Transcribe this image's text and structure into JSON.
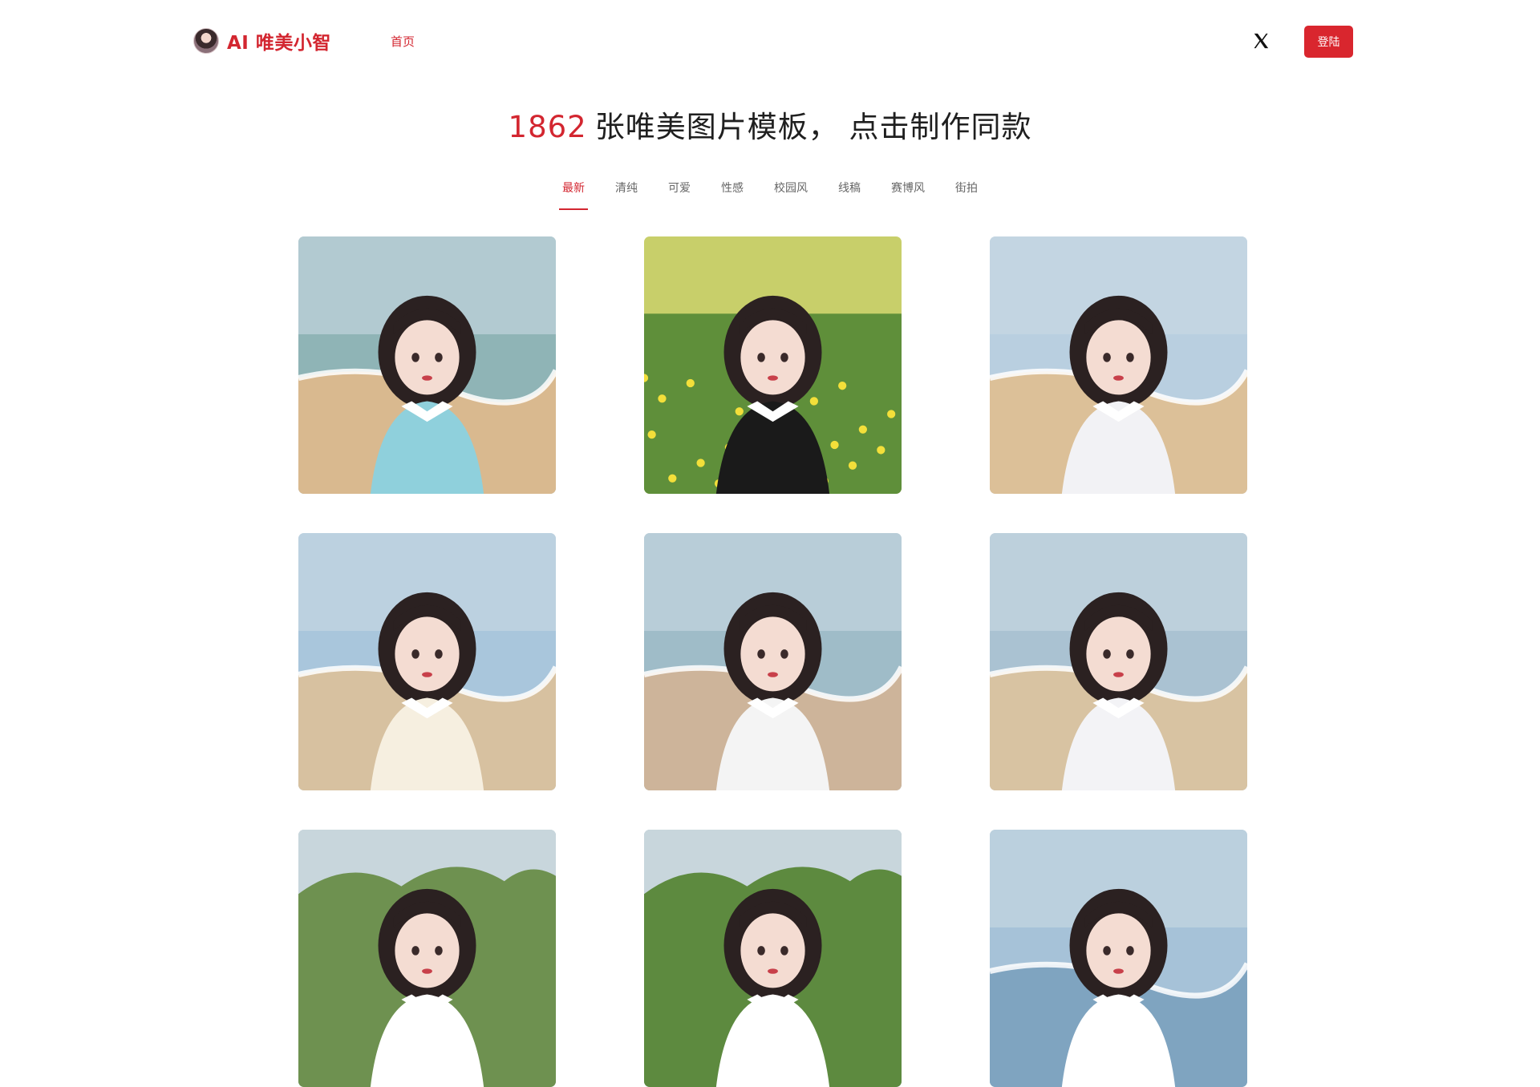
{
  "header": {
    "brand": "AI 唯美小智",
    "nav_home": "首页",
    "login_label": "登陆"
  },
  "hero": {
    "count": "1862",
    "text": "张唯美图片模板， 点击制作同款"
  },
  "tabs": [
    {
      "label": "最新",
      "active": true
    },
    {
      "label": "清纯",
      "active": false
    },
    {
      "label": "可爱",
      "active": false
    },
    {
      "label": "性感",
      "active": false
    },
    {
      "label": "校园风",
      "active": false
    },
    {
      "label": "线稿",
      "active": false
    },
    {
      "label": "赛博风",
      "active": false
    },
    {
      "label": "街拍",
      "active": false
    }
  ],
  "colors": {
    "accent": "#d32630",
    "button_bg": "#d9262e"
  },
  "icons": {
    "x": "x-logo-icon",
    "avatar": "avatar"
  },
  "gallery": [
    {
      "scene": "beach",
      "sky": "#8fb4b6",
      "ground": "#d9b98f",
      "dress": "#8fd0dc"
    },
    {
      "scene": "meadow",
      "sky": "#c8cf6a",
      "ground": "#5f8f3a",
      "dress": "#1a1a1a"
    },
    {
      "scene": "beach",
      "sky": "#b9cfe0",
      "ground": "#dcc098",
      "dress": "#f2f2f5"
    },
    {
      "scene": "beach",
      "sky": "#a9c6dc",
      "ground": "#d7c1a0",
      "dress": "#f6efe0"
    },
    {
      "scene": "beach",
      "sky": "#9fbcc8",
      "ground": "#cdb49a",
      "dress": "#f4f4f4"
    },
    {
      "scene": "beach",
      "sky": "#aac2d2",
      "ground": "#d8c3a2",
      "dress": "#f3f3f6"
    },
    {
      "scene": "forest",
      "sky": "#b3c7cf",
      "ground": "#6e9150",
      "dress": "#ffffff"
    },
    {
      "scene": "forest",
      "sky": "#a7bfc6",
      "ground": "#5d8a3f",
      "dress": "#ffffff"
    },
    {
      "scene": "beach",
      "sky": "#a6c2d8",
      "ground": "#7fa4c0",
      "dress": "#ffffff"
    }
  ]
}
